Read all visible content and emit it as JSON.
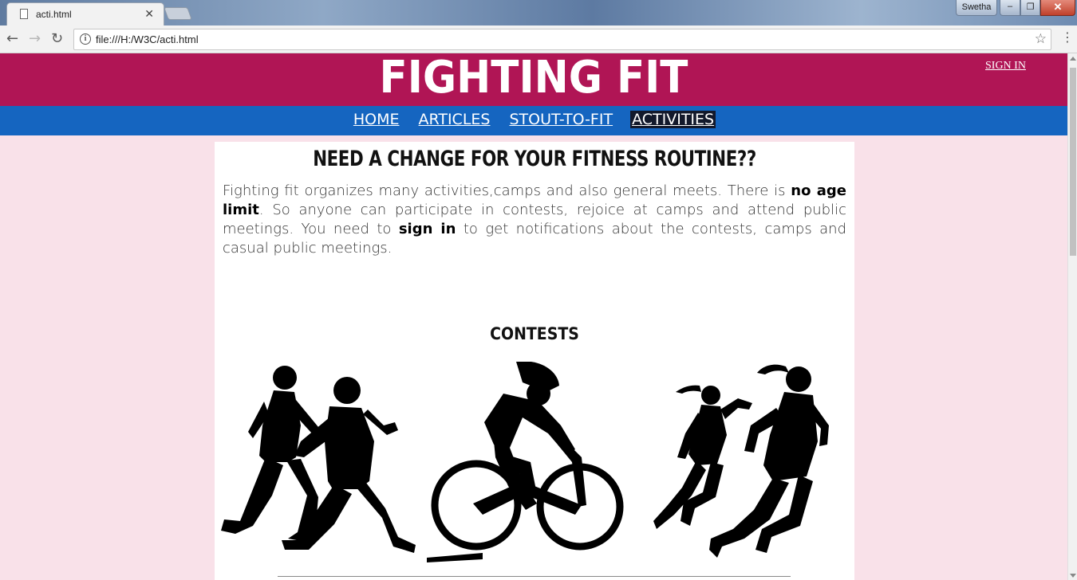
{
  "browser": {
    "tab_title": "acti.html",
    "tab_close": "✕",
    "url": "file:///H:/W3C/acti.html",
    "user": "Swetha",
    "window_buttons": {
      "minimize": "‒",
      "maximize": "❐",
      "close": "✕"
    },
    "icons": {
      "back": "←",
      "forward": "→",
      "reload": "↻",
      "info": "i",
      "star": "☆",
      "menu": "⋮"
    }
  },
  "header": {
    "site_title": "FIGHTING FIT",
    "signin": "SIGN IN",
    "brand_color": "#b01555"
  },
  "nav": {
    "bar_color": "#1565c0",
    "items": [
      {
        "label": "HOME",
        "active": false
      },
      {
        "label": "ARTICLES",
        "active": false
      },
      {
        "label": "STOUT-TO-FIT",
        "active": false
      },
      {
        "label": "ACTIVITIES",
        "active": true
      }
    ]
  },
  "main": {
    "heading": "NEED A CHANGE FOR YOUR FITNESS ROUTINE??",
    "intro": {
      "part1": "Fighting fit organizes many activities,camps and also general meets. There is ",
      "bold1": "no age limit",
      "part2": ". So anyone can participate in contests, rejoice at camps and attend public meetings. You need to ",
      "bold2": "sign in",
      "part3": " to get notifications about the contests, camps and casual public meetings."
    },
    "section_heading": "CONTESTS",
    "images": [
      {
        "name": "runners-image",
        "icon": "two-male-runners-silhouette"
      },
      {
        "name": "cyclist-image",
        "icon": "cyclist-silhouette"
      },
      {
        "name": "female-runners-image",
        "icon": "two-female-runners-silhouette"
      }
    ]
  },
  "colors": {
    "page_background": "#f9e1e9",
    "card_background": "#ffffff",
    "active_nav_background": "#13192b"
  }
}
